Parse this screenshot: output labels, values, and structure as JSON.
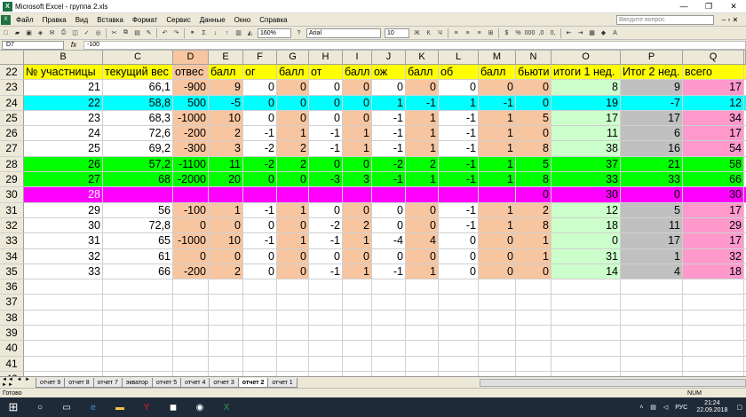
{
  "window": {
    "title": "Microsoft Excel - группа 2.xls"
  },
  "menu": [
    "Файл",
    "Правка",
    "Вид",
    "Вставка",
    "Формат",
    "Сервис",
    "Данные",
    "Окно",
    "Справка"
  ],
  "ask_placeholder": "Введите вопрос",
  "toolbar": {
    "zoom": "160%",
    "font": "Arial",
    "size": "10"
  },
  "formula": {
    "name": "D7",
    "value": "-100"
  },
  "columns": [
    "B",
    "C",
    "D",
    "E",
    "F",
    "G",
    "H",
    "I",
    "J",
    "K",
    "L",
    "M",
    "N",
    "O",
    "P",
    "Q"
  ],
  "selected_col": "D",
  "header_row": {
    "num": "22",
    "cells": [
      "№ участницы",
      "текущий вес",
      "отвес",
      "балл",
      "ог",
      "балл",
      "от",
      "балл",
      "ож",
      "балл",
      "об",
      "балл",
      "бьюти",
      "итоги 1 нед.",
      "Итог 2 нед.",
      "всего"
    ]
  },
  "rows": [
    {
      "num": "23",
      "cls": "w",
      "v": [
        "21",
        "66,1",
        "-900",
        "9",
        "0",
        "0",
        "0",
        "0",
        "0",
        "0",
        "0",
        "0",
        "0",
        "8",
        "9",
        "17"
      ]
    },
    {
      "num": "24",
      "cls": "cyan",
      "v": [
        "22",
        "58,8",
        "500",
        "-5",
        "0",
        "0",
        "0",
        "0",
        "1",
        "-1",
        "1",
        "-1",
        "0",
        "19",
        "-7",
        "12"
      ]
    },
    {
      "num": "25",
      "cls": "w",
      "v": [
        "23",
        "68,3",
        "-1000",
        "10",
        "0",
        "0",
        "0",
        "0",
        "-1",
        "1",
        "-1",
        "1",
        "5",
        "17",
        "17",
        "34"
      ]
    },
    {
      "num": "26",
      "cls": "w",
      "v": [
        "24",
        "72,6",
        "-200",
        "2",
        "-1",
        "1",
        "-1",
        "1",
        "-1",
        "1",
        "-1",
        "1",
        "0",
        "11",
        "6",
        "17"
      ]
    },
    {
      "num": "27",
      "cls": "w",
      "v": [
        "25",
        "69,2",
        "-300",
        "3",
        "-2",
        "2",
        "-1",
        "1",
        "-1",
        "1",
        "-1",
        "1",
        "8",
        "38",
        "16",
        "54"
      ]
    },
    {
      "num": "28",
      "cls": "green",
      "v": [
        "26",
        "57,2",
        "-1100",
        "11",
        "-2",
        "2",
        "0",
        "0",
        "-2",
        "2",
        "-1",
        "1",
        "5",
        "37",
        "21",
        "58"
      ]
    },
    {
      "num": "29",
      "cls": "green",
      "v": [
        "27",
        "68",
        "-2000",
        "20",
        "0",
        "0",
        "-3",
        "3",
        "-1",
        "1",
        "-1",
        "1",
        "8",
        "33",
        "33",
        "66"
      ]
    },
    {
      "num": "30",
      "cls": "mag",
      "v": [
        "28",
        "",
        "",
        "",
        "",
        "",
        "",
        "",
        "",
        "",
        "",
        "",
        "0",
        "30",
        "0",
        "30"
      ]
    },
    {
      "num": "31",
      "cls": "w",
      "v": [
        "29",
        "56",
        "-100",
        "1",
        "-1",
        "1",
        "0",
        "0",
        "0",
        "0",
        "-1",
        "1",
        "2",
        "12",
        "5",
        "17"
      ]
    },
    {
      "num": "32",
      "cls": "w",
      "v": [
        "30",
        "72,8",
        "0",
        "0",
        "0",
        "0",
        "-2",
        "2",
        "0",
        "0",
        "-1",
        "1",
        "8",
        "18",
        "11",
        "29"
      ]
    },
    {
      "num": "33",
      "cls": "w",
      "v": [
        "31",
        "65",
        "-1000",
        "10",
        "-1",
        "1",
        "-1",
        "1",
        "-4",
        "4",
        "0",
        "0",
        "1",
        "0",
        "17",
        "17"
      ]
    },
    {
      "num": "34",
      "cls": "w",
      "v": [
        "32",
        "61",
        "0",
        "0",
        "0",
        "0",
        "0",
        "0",
        "0",
        "0",
        "0",
        "0",
        "1",
        "31",
        "1",
        "32"
      ]
    },
    {
      "num": "35",
      "cls": "w",
      "v": [
        "33",
        "66",
        "-200",
        "2",
        "0",
        "0",
        "-1",
        "1",
        "-1",
        "1",
        "0",
        "0",
        "0",
        "14",
        "4",
        "18"
      ]
    },
    {
      "num": "36",
      "cls": "empty",
      "v": []
    },
    {
      "num": "37",
      "cls": "empty",
      "v": []
    },
    {
      "num": "38",
      "cls": "empty",
      "v": []
    },
    {
      "num": "39",
      "cls": "empty",
      "v": []
    },
    {
      "num": "40",
      "cls": "empty",
      "v": []
    },
    {
      "num": "41",
      "cls": "empty",
      "v": []
    },
    {
      "num": "42",
      "cls": "empty",
      "v": []
    }
  ],
  "sheets": [
    "отчет 9",
    "отчет 8",
    "отчет 7",
    "экватор",
    "отчет 5",
    "отчет 4",
    "отчет 3",
    "отчет 2",
    "отчет 1"
  ],
  "active_sheet": "отчет 2",
  "status": {
    "left": "Готово",
    "num": "NUM"
  },
  "clock": {
    "time": "21:24",
    "date": "22.09.2018",
    "lang": "РУС"
  },
  "colors": {
    "peach": "#f7c59f",
    "green": "#00ff00",
    "cyan": "#00ffff",
    "magenta": "#ff00ff",
    "pink": "#ff99cc",
    "lightgreen": "#ccffcc",
    "gray": "#c0c0c0",
    "yellow": "#ffff00"
  }
}
